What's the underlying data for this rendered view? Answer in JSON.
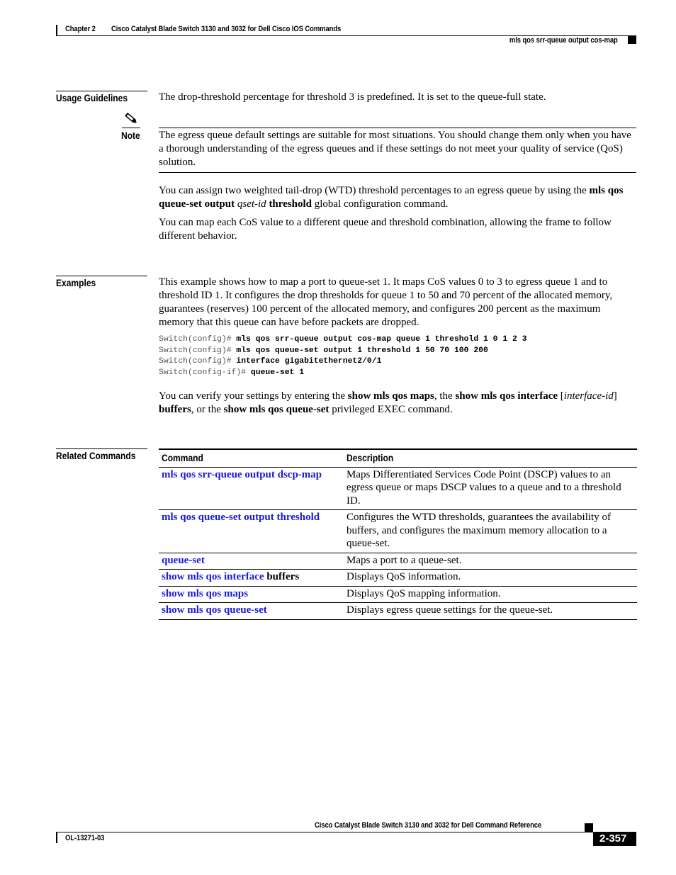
{
  "header": {
    "chapter": "Chapter 2",
    "chapter_title": "Cisco Catalyst Blade Switch 3130 and 3032 for Dell Cisco IOS Commands",
    "command_name": "mls qos srr-queue output cos-map"
  },
  "usage_guidelines": {
    "label": "Usage Guidelines",
    "intro": "The drop-threshold percentage for threshold 3 is predefined. It is set to the queue-full state.",
    "note": {
      "icon": "pencil-note-icon",
      "label": "Note",
      "text": "The egress queue default settings are suitable for most situations. You should change them only when you have a thorough understanding of the egress queues and if these settings do not meet your quality of service (QoS) solution."
    },
    "para1": {
      "t1": "You can assign two weighted tail-drop (WTD) threshold percentages to an egress queue by using the ",
      "b1": "mls qos queue-set output",
      "t2": " ",
      "i1": "qset-id",
      "t3": " ",
      "b2": "threshold",
      "t4": " global configuration command."
    },
    "para2": "You can map each CoS value to a different queue and threshold combination, allowing the frame to follow different behavior."
  },
  "examples": {
    "label": "Examples",
    "intro": "This example shows how to map a port to queue-set 1. It maps CoS values 0 to 3 to egress queue 1 and to threshold ID 1. It configures the drop thresholds for queue 1 to 50 and 70 percent of the allocated memory, guarantees (reserves) 100 percent of the allocated memory, and configures 200 percent as the maximum memory that this queue can have before packets are dropped.",
    "code": [
      {
        "prompt": "Switch(config)# ",
        "cmd": "mls qos srr-queue output cos-map queue 1 threshold 1 0 1 2 3"
      },
      {
        "prompt": "Switch(config)# ",
        "cmd": "mls qos queue-set output 1 threshold 1 50 70 100 200"
      },
      {
        "prompt": "Switch(config)# ",
        "cmd": "interface gigabitethernet2/0/1"
      },
      {
        "prompt": "Switch(config-if)# ",
        "cmd": "queue-set 1"
      }
    ],
    "verify": {
      "t1": "You can verify your settings by entering the ",
      "b1": "show mls qos maps",
      "t2": ", the ",
      "b2": "show mls qos interface",
      "t3": " [",
      "i1": "interface-id",
      "t4": "] ",
      "b3": "buffers",
      "t5": ", or the ",
      "b4": "show mls qos queue-set",
      "t6": " privileged EXEC command."
    }
  },
  "related_commands": {
    "label": "Related Commands",
    "columns": [
      "Command",
      "Description"
    ],
    "rows": [
      {
        "command": "mls qos srr-queue output dscp-map",
        "suffix": "",
        "description": "Maps Differentiated Services Code Point (DSCP) values to an egress queue or maps DSCP values to a queue and to a threshold ID."
      },
      {
        "command": "mls qos queue-set output threshold",
        "suffix": "",
        "description": "Configures the WTD thresholds, guarantees the availability of buffers, and configures the maximum memory allocation to a queue-set."
      },
      {
        "command": "queue-set",
        "suffix": "",
        "description": "Maps a port to a queue-set."
      },
      {
        "command": "show mls qos interface",
        "suffix": " buffers",
        "description": "Displays QoS information."
      },
      {
        "command": "show mls qos maps",
        "suffix": "",
        "description": "Displays QoS mapping information."
      },
      {
        "command": "show mls qos queue-set",
        "suffix": "",
        "description": "Displays egress queue settings for the queue-set."
      }
    ]
  },
  "footer": {
    "book_title": "Cisco Catalyst Blade Switch 3130 and 3032 for Dell Command Reference",
    "doc_number": "OL-13271-03",
    "page_number": "2-357"
  },
  "colors": {
    "link": "#1a1adb",
    "text": "#000000",
    "code_prompt": "#555555"
  }
}
